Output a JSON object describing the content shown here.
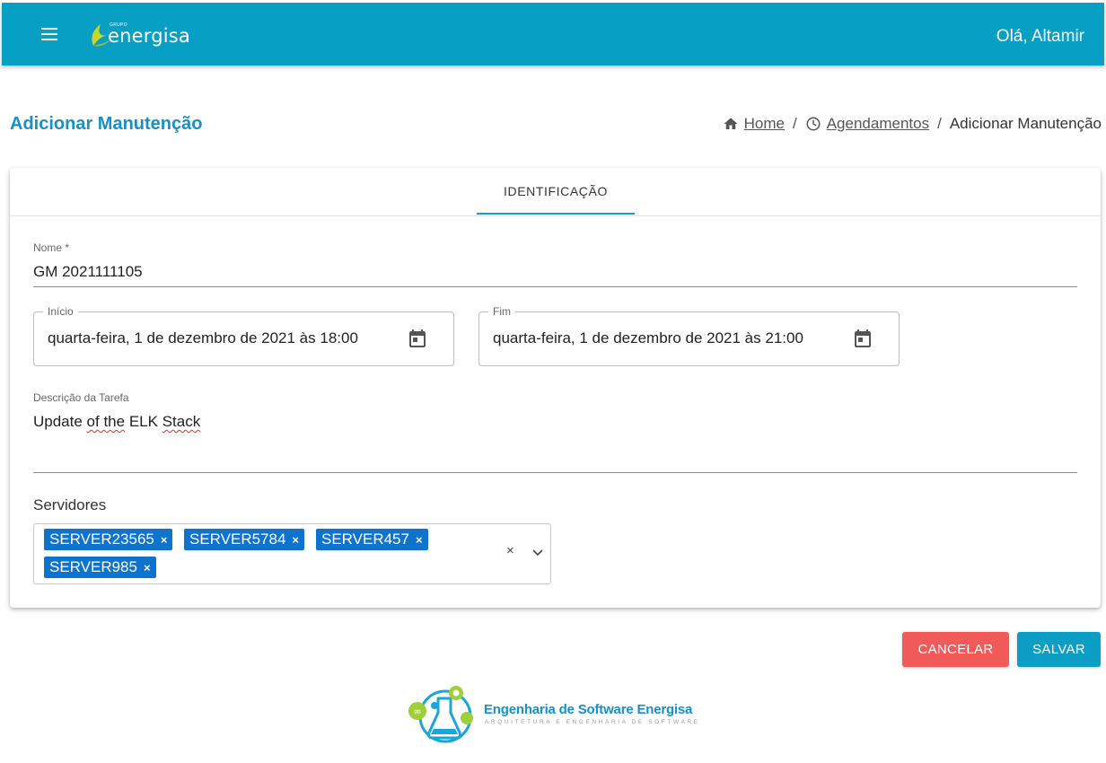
{
  "header": {
    "logo_text": "energisa",
    "logo_small": "GRUPO",
    "greeting": "Olá, Altamir",
    "menu_icon": "hamburger-menu-icon"
  },
  "page": {
    "title": "Adicionar Manutenção"
  },
  "breadcrumb": {
    "home": "Home",
    "sep1": "/",
    "schedules": "Agendamentos",
    "sep2": "/",
    "current": "Adicionar Manutenção"
  },
  "tabs": [
    {
      "label": "IDENTIFICAÇÃO",
      "active": true
    }
  ],
  "form": {
    "name_label": "Nome *",
    "name_value": "GM 2021111105",
    "start_label": "Início",
    "start_value": "quarta-feira, 1 de dezembro de 2021 às 18:00",
    "end_label": "Fim",
    "end_value": "quarta-feira, 1 de dezembro de 2021 às 21:00",
    "desc_label": "Descrição da Tarefa",
    "desc_part1": "Update ",
    "desc_part2": "of the",
    "desc_part3": " ELK ",
    "desc_part4": "Stack",
    "servers_label": "Servidores",
    "servers": [
      "SERVER23565",
      "SERVER5784",
      "SERVER457",
      "SERVER985"
    ],
    "chip_remove": "×",
    "clear_all": "×"
  },
  "buttons": {
    "cancel": "CANCELAR",
    "save": "SALVAR"
  },
  "footer": {
    "title": "Engenharia de Software Energisa",
    "subtitle": "ARQUITETURA E ENGENHARIA DE SOFTWARE"
  },
  "colors": {
    "topbar": "#079fc4",
    "title": "#1690c6",
    "chip": "#0e73cc",
    "cancel": "#f25a5a",
    "save": "#0d9ec5"
  }
}
